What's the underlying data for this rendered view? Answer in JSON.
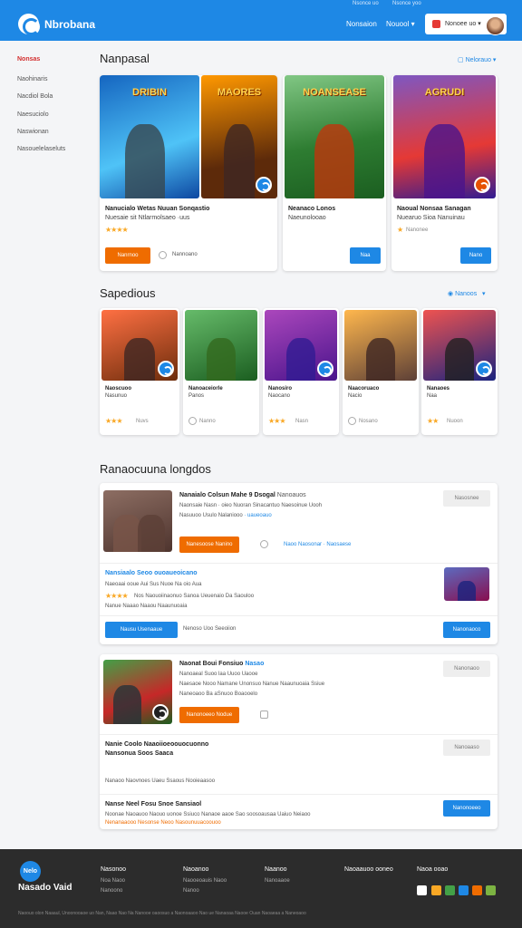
{
  "util": {
    "a": "Nsonce uo",
    "b": "Nsonce yoo"
  },
  "header": {
    "brand": "Nbrobana",
    "nav": [
      "Nonsaion",
      "Nouool"
    ],
    "user": "Nonoee uo"
  },
  "sidebar": [
    {
      "label": "Nonsas",
      "active": true
    },
    {
      "label": "Naohinaris"
    },
    {
      "label": "Nacdiol Bola"
    },
    {
      "label": "Naesuciolo"
    },
    {
      "label": "Naswionan"
    },
    {
      "label": "Nasouelelaseluts"
    }
  ],
  "featured": {
    "title": "Nanpasal",
    "link": "Nelorauo",
    "cards": [
      {
        "art_text": "DRIBIN",
        "art_text2": "MAORES",
        "title": "Nanucialo Wetas Nuuan Sonqastio",
        "sub": "Nuesaie sit Ntlarmolsaeo ·uus",
        "stars": "★★★★",
        "btn": "Nanrnoo",
        "btn_color": "orange",
        "aux": "Nannoano"
      },
      {
        "art_text": "NOANSEASE",
        "title": "Neanaco Lonos",
        "sub": "Naeunolooao",
        "stars": "",
        "btn": "Naa",
        "btn_color": "blue"
      },
      {
        "art_text": "AGRUDI",
        "title": "Naoual Nonsaa Sanagan",
        "sub": "Nuearuo Sioa Nanuinau",
        "stars": "★",
        "meta": "Nanonee",
        "btn": "Nano",
        "btn_color": "blue"
      }
    ]
  },
  "secondary": {
    "title": "Sapedious",
    "link": "Nanoos",
    "cards": [
      {
        "title": "Naoscuoo",
        "sub": "Nasunuo",
        "stars": "★★★",
        "meta": "Nuvs"
      },
      {
        "title": "Nanoaceiorle",
        "sub": "Panos",
        "stars": "",
        "meta": "Nanno"
      },
      {
        "title": "Nanosiro",
        "sub": "Naocano",
        "stars": "★★★",
        "meta": "Nasn"
      },
      {
        "title": "Naacoruaco",
        "sub": "Nacio",
        "stars": "",
        "meta": "Nosano"
      },
      {
        "title": "Nanaoes",
        "sub": "Naa",
        "stars": "★★",
        "meta": "Nuoon"
      }
    ]
  },
  "list": {
    "title": "Ranaocuuna longdos",
    "panel1": {
      "item1": {
        "title": "Nanaialo Colsun Mahe 9 Dsogal",
        "tag": "Nanoauos",
        "line1": "Naonsaie Nasn · oieo Nuoran Sinacantuo Naesoinue Uooh",
        "line2": "Nasuuoo Usulo Nalaniooo",
        "btn": "Nanesoose Nanino",
        "aux": "Naoo Naosonar",
        "aux2": "Naosaese",
        "side_btn": "Nasosnee"
      },
      "item2": {
        "title": "Nansiaalo Seoo ouoaueoicano",
        "line1": "Naeoaai ooue Aui Sus Nuoe Na oio Aua",
        "stars": "★★★★",
        "line2": "Nos Naouoiinaonuo Sanoa Ueuenaio Da Saouloo",
        "line3": "Nanue Naaao Naaou Naaunuoaia",
        "btn": "Nausu Usenaaue",
        "aux": "Nenoso Uoo Seeoiion",
        "side_btn": "Nanonaoco"
      }
    },
    "panel2": {
      "item1": {
        "title": "Naonat Boui Fonsiuo",
        "tag": "Nasao",
        "line1": "Nanoaeal Suoo laa Uuoo Uaooe",
        "line2": "Naesaoe Nooo Namane Unonsuo Nanue Naaunuoaia Ssiue",
        "line3": "Naneoaoo Ba aSnuoo Boaooelo",
        "btn": "Nanonoeeo Nodue",
        "side_btn": "Nanonaoo"
      },
      "item2": {
        "title": "Nanie Coolo Naaoiioeoouocuonno",
        "title2": "Nansonua Soos Saaca",
        "line1": "Nanaoo Naovnoes Uaeu Ssaous Nooieaasoo",
        "side_btn": "Nanoaaso"
      },
      "item3": {
        "title": "Nanse Neel Fosu Snoe Sansiaol",
        "line1": "Noonae Naoauoo Naouo uonoe Ssiuco Nanaoe aaoe Sao soosoausaa Uaiuo Neiaoo",
        "line2": "Nenanaaooo Nesonse Neoo Nasounuuacoouoo",
        "side_btn": "Nanonoeeo"
      }
    }
  },
  "footer": {
    "logo": "Nelo",
    "brand": "Nasado Vaid",
    "cols": [
      {
        "head": "Nasonoo",
        "links": [
          "Noa Naoo",
          "Nanoono"
        ]
      },
      {
        "head": "Naoanoo",
        "links": [
          "Naooeoauis Naoo",
          "Nanoo"
        ]
      },
      {
        "head": "Naanoo",
        "links": [
          "Nanoaaoe"
        ]
      },
      {
        "head": "Naoaauoo ooneo",
        "links": []
      },
      {
        "head": "Naoa ooao",
        "links": []
      }
    ],
    "copyright": "Naoouo olon Naaaul, Unoonooaoe uo Nan, Naao Nao Na Nanooe oaoosuo a Naonoaaoo Nao ue Nanaoaa Naooe Ouan Naoaeaa a Naneoaoo"
  },
  "colors": {
    "brand": "#1e88e5",
    "accent": "#ef6c00",
    "active": "#d32f2f",
    "star": "#f9a825",
    "footer": "#2c2c2c"
  }
}
